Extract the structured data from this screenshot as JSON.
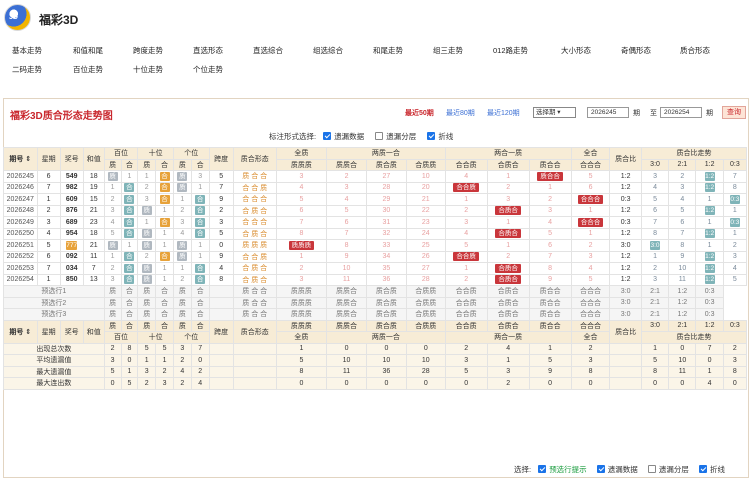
{
  "app": {
    "title": "福彩3D",
    "logo_text": "3D"
  },
  "nav": {
    "row1": [
      "基本走势",
      "和值和尾",
      "跨度走势",
      "直选形态",
      "直选综合",
      "组选综合",
      "和尾走势",
      "组三走势",
      "012路走势",
      "大小形态",
      "奇偶形态",
      "质合形态"
    ],
    "row2": [
      "二码走势",
      "百位走势",
      "十位走势",
      "个位走势"
    ]
  },
  "panel": {
    "title": "福彩3D质合形态走势图",
    "recent": [
      "最近50期",
      "最近80期",
      "最近120期"
    ],
    "select": "选择期 ▾",
    "from": "2026245",
    "to": "2026254",
    "qi": "期",
    "zhi": "至",
    "query": "查询",
    "options_label": "标注形式选择:",
    "opt1": "遗漏数据",
    "opt2": "遗漏分层",
    "opt3": "折线"
  },
  "header": {
    "h1": [
      "期号 ⇕",
      "星期",
      "奖号",
      "和值",
      "百位",
      "十位",
      "个位",
      "跨度",
      "质合形态",
      "全质",
      "两质一合",
      "两合一质",
      "全合",
      "质合比",
      "质合比走势"
    ],
    "sub": [
      "质",
      "合",
      "质",
      "合",
      "质",
      "合",
      "质质质",
      "质质合",
      "质合质",
      "合质质",
      "合合质",
      "合质合",
      "质合合",
      "合合合",
      "3:0",
      "2:1",
      "1:2",
      "0:3"
    ]
  },
  "rows": [
    {
      "p": "2026245",
      "w": "6",
      "n": "549",
      "s": "18",
      "b": [
        "质",
        "1"
      ],
      "t": [
        "1",
        "合"
      ],
      "g": [
        "质",
        "3"
      ],
      "k": "5",
      "f": "质 合 合",
      "q": "3",
      "lz": [
        "2",
        "27",
        "10"
      ],
      "lh": [
        "4",
        "1",
        "质合合"
      ],
      "hq": "5",
      "r": "1:2",
      "tr": [
        "3",
        "2",
        "1:2",
        "7"
      ]
    },
    {
      "p": "2026246",
      "w": "7",
      "n": "982",
      "s": "19",
      "b": [
        "1",
        "合"
      ],
      "t": [
        "2",
        "合"
      ],
      "g": [
        "质",
        "1"
      ],
      "k": "7",
      "f": "合 合 质",
      "q": "4",
      "lz": [
        "3",
        "28",
        "20"
      ],
      "lh": [
        "合合质",
        "2",
        "1"
      ],
      "hq": "6",
      "r": "1:2",
      "tr": [
        "4",
        "3",
        "1:2",
        "8"
      ]
    },
    {
      "p": "2026247",
      "w": "1",
      "n": "609",
      "s": "15",
      "b": [
        "2",
        "合"
      ],
      "t": [
        "3",
        "合"
      ],
      "g": [
        "1",
        "合"
      ],
      "k": "9",
      "f": "合 合 合",
      "q": "5",
      "lz": [
        "4",
        "29",
        "21"
      ],
      "lh": [
        "1",
        "3",
        "2"
      ],
      "hq": "合合合",
      "r": "0:3",
      "tr": [
        "5",
        "4",
        "1",
        "0:3"
      ]
    },
    {
      "p": "2026248",
      "w": "2",
      "n": "876",
      "s": "21",
      "b": [
        "3",
        "合"
      ],
      "t": [
        "质",
        "1"
      ],
      "g": [
        "2",
        "合"
      ],
      "k": "2",
      "f": "合 质 合",
      "q": "6",
      "lz": [
        "5",
        "30",
        "22"
      ],
      "lh": [
        "2",
        "合质合",
        "3"
      ],
      "hq": "1",
      "r": "1:2",
      "tr": [
        "6",
        "5",
        "1:2",
        "1"
      ]
    },
    {
      "p": "2026249",
      "w": "3",
      "n": "689",
      "s": "23",
      "b": [
        "4",
        "合"
      ],
      "t": [
        "1",
        "合"
      ],
      "g": [
        "3",
        "合"
      ],
      "k": "3",
      "f": "合 合 合",
      "q": "7",
      "lz": [
        "6",
        "31",
        "23"
      ],
      "lh": [
        "3",
        "1",
        "4"
      ],
      "hq": "合合合",
      "r": "0:3",
      "tr": [
        "7",
        "6",
        "1",
        "0:3"
      ]
    },
    {
      "p": "2026250",
      "w": "4",
      "n": "954",
      "s": "18",
      "b": [
        "5",
        "合"
      ],
      "t": [
        "质",
        "1"
      ],
      "g": [
        "4",
        "合"
      ],
      "k": "5",
      "f": "合 质 合",
      "q": "8",
      "lz": [
        "7",
        "32",
        "24"
      ],
      "lh": [
        "4",
        "合质合",
        "5"
      ],
      "hq": "1",
      "r": "1:2",
      "tr": [
        "8",
        "7",
        "1:2",
        "1"
      ]
    },
    {
      "p": "2026251",
      "w": "5",
      "n": "777",
      "s": "21",
      "b": [
        "质",
        "1"
      ],
      "t": [
        "质",
        "1"
      ],
      "g": [
        "质",
        "1"
      ],
      "k": "0",
      "f": "质 质 质",
      "q": "质质质",
      "lz": [
        "8",
        "33",
        "25"
      ],
      "lh": [
        "5",
        "1",
        "6"
      ],
      "hq": "2",
      "r": "3:0",
      "tr": [
        "3:0",
        "8",
        "1",
        "2"
      ]
    },
    {
      "p": "2026252",
      "w": "6",
      "n": "092",
      "s": "11",
      "b": [
        "1",
        "合"
      ],
      "t": [
        "2",
        "合"
      ],
      "g": [
        "质",
        "1"
      ],
      "k": "9",
      "f": "合 合 质",
      "q": "1",
      "lz": [
        "9",
        "34",
        "26"
      ],
      "lh": [
        "合合质",
        "2",
        "7"
      ],
      "hq": "3",
      "r": "1:2",
      "tr": [
        "1",
        "9",
        "1:2",
        "3"
      ]
    },
    {
      "p": "2026253",
      "w": "7",
      "n": "034",
      "s": "7",
      "b": [
        "2",
        "合"
      ],
      "t": [
        "质",
        "1"
      ],
      "g": [
        "1",
        "合"
      ],
      "k": "4",
      "f": "合 质 合",
      "q": "2",
      "lz": [
        "10",
        "35",
        "27"
      ],
      "lh": [
        "1",
        "合质合",
        "8"
      ],
      "hq": "4",
      "r": "1:2",
      "tr": [
        "2",
        "10",
        "1:2",
        "4"
      ]
    },
    {
      "p": "2026254",
      "w": "1",
      "n": "850",
      "s": "13",
      "b": [
        "3",
        "合"
      ],
      "t": [
        "质",
        "1"
      ],
      "g": [
        "2",
        "合"
      ],
      "k": "8",
      "f": "合 质 合",
      "q": "3",
      "lz": [
        "11",
        "36",
        "28"
      ],
      "lh": [
        "2",
        "合质合",
        "9"
      ],
      "hq": "5",
      "r": "1:2",
      "tr": [
        "3",
        "11",
        "1:2",
        "5"
      ]
    }
  ],
  "pre": [
    {
      "label": "预选行1"
    },
    {
      "label": "预选行2"
    },
    {
      "label": "预选行3"
    }
  ],
  "pre_cells": [
    "质",
    "合",
    "质",
    "合",
    "质",
    "合",
    "质 合 合",
    "质质质",
    "质质合",
    "质合质",
    "合质质",
    "合合质",
    "合质合",
    "质合合",
    "合合合",
    "3:0",
    "2:1",
    "1:2",
    "0:3"
  ],
  "foot_header": {
    "h1": [
      "期号 ⇕",
      "星期",
      "奖号",
      "和值",
      "质",
      "合",
      "质",
      "合",
      "质",
      "合",
      "跨度",
      "质合形态",
      "质质质",
      "质质合",
      "质合质",
      "合质质",
      "合合质",
      "合质合",
      "质合合",
      "合合合",
      "质合比",
      "3:0",
      "2:1",
      "1:2",
      "0:3"
    ],
    "h2": [
      "百位",
      "十位",
      "个位",
      "全质",
      "两质一合",
      "两合一质",
      "全合",
      "质合比走势"
    ]
  },
  "stats": [
    {
      "label": "出现总次数",
      "v": [
        "2",
        "8",
        "5",
        "5",
        "3",
        "7",
        "1",
        "0",
        "0",
        "0",
        "2",
        "4",
        "1",
        "2",
        "1",
        "0",
        "7",
        "2"
      ]
    },
    {
      "label": "平均遗漏值",
      "v": [
        "3",
        "0",
        "1",
        "1",
        "2",
        "0",
        "5",
        "10",
        "10",
        "10",
        "3",
        "1",
        "5",
        "3",
        "5",
        "10",
        "0",
        "3"
      ]
    },
    {
      "label": "最大遗漏值",
      "v": [
        "5",
        "1",
        "3",
        "2",
        "4",
        "2",
        "8",
        "11",
        "36",
        "28",
        "5",
        "3",
        "9",
        "8",
        "8",
        "11",
        "1",
        "8"
      ]
    },
    {
      "label": "最大连出数",
      "v": [
        "0",
        "5",
        "2",
        "3",
        "2",
        "4",
        "0",
        "0",
        "0",
        "0",
        "0",
        "2",
        "0",
        "0",
        "0",
        "0",
        "4",
        "0"
      ]
    }
  ],
  "bottom": {
    "label": "选择:",
    "o1": "预选行提示",
    "o2": "遗漏数据",
    "o3": "遗漏分层",
    "o4": "折线"
  },
  "colors": {
    "red": "#c9363b",
    "teal": "#7fb4b8",
    "orange": "#e7a23a",
    "header": "#f7ecd6",
    "title": "#c9272d"
  }
}
